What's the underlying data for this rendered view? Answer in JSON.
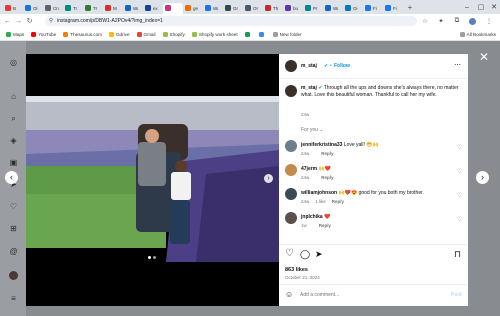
{
  "browser": {
    "tabs": [
      {
        "label": "B",
        "color": "#e53935"
      },
      {
        "label": "Ol",
        "color": "#1976d2"
      },
      {
        "label": "Cn",
        "color": "#616161"
      },
      {
        "label": "Tr",
        "color": "#00897b"
      },
      {
        "label": "Tr",
        "color": "#2e7d32"
      },
      {
        "label": "M",
        "color": "#d32f2f"
      },
      {
        "label": "Wi",
        "color": "#1565c0"
      },
      {
        "label": "ex",
        "color": "#0d47a1"
      },
      {
        "label": "",
        "color": "#c13584",
        "active": true
      },
      {
        "label": "ge",
        "color": "#ef6c00"
      },
      {
        "label": "Wi",
        "color": "#1a73e8"
      },
      {
        "label": "Gr",
        "color": "#37474f"
      },
      {
        "label": "OI",
        "color": "#455a64"
      },
      {
        "label": "Th",
        "color": "#c62828"
      },
      {
        "label": "bu",
        "color": "#5e35b1"
      },
      {
        "label": "Pr",
        "color": "#00838f"
      },
      {
        "label": "Wi",
        "color": "#1565c0"
      },
      {
        "label": "Oi",
        "color": "#0277bd"
      },
      {
        "label": "Fi",
        "color": "#1877f2"
      },
      {
        "label": "Fi",
        "color": "#1877f2"
      }
    ],
    "url": "instagram.com/p/DBW1-A2POv4/?img_index=1",
    "bookmarks": [
      {
        "label": "Maps",
        "color": "#34a853"
      },
      {
        "label": "YouTube",
        "color": "#ff0000"
      },
      {
        "label": "Thesaurus.com",
        "color": "#f57c00"
      },
      {
        "label": "Gdrive",
        "color": "#fbbc04"
      },
      {
        "label": "Gmail",
        "color": "#ea4335"
      },
      {
        "label": "Shopify",
        "color": "#95bf47"
      },
      {
        "label": "Shopify work sheet",
        "color": "#95bf47"
      },
      {
        "label": "",
        "color": "#0f9d58"
      },
      {
        "label": "",
        "color": "#4285f4"
      },
      {
        "label": "New folder",
        "color": "#9e9e9e"
      }
    ],
    "all_bookmarks": "All Bookmarks"
  },
  "post": {
    "username": "m_staj",
    "follow": "Follow",
    "caption": "Through all the ups and downs she's always there, no matter what. Love this beautiful woman. Thankful to call her my wife.",
    "caption_age": "24w",
    "for_you": "For you",
    "likes": "863 likes",
    "date": "October 21, 2024",
    "add_comment_placeholder": "Add a comment...",
    "post_button": "Post"
  },
  "comments": [
    {
      "user": "jenniferkristina33",
      "text": "Love yall! 😁🙌",
      "age": "24w",
      "likes": "",
      "reply": "Reply",
      "avatar": "#6d7f8c"
    },
    {
      "user": "47jerm",
      "text": "🙌❤️",
      "age": "24w",
      "likes": "",
      "reply": "Reply",
      "avatar": "#c28b4a"
    },
    {
      "user": "williamjohnson",
      "text": "🙌❤️😍 good for you both my brother.",
      "age": "24w",
      "likes": "1 like",
      "reply": "Reply",
      "avatar": "#3c4a55"
    },
    {
      "user": "jnplchika",
      "text": "❤️",
      "age": "1w",
      "likes": "",
      "reply": "Reply",
      "avatar": "#5a4f4a"
    }
  ]
}
